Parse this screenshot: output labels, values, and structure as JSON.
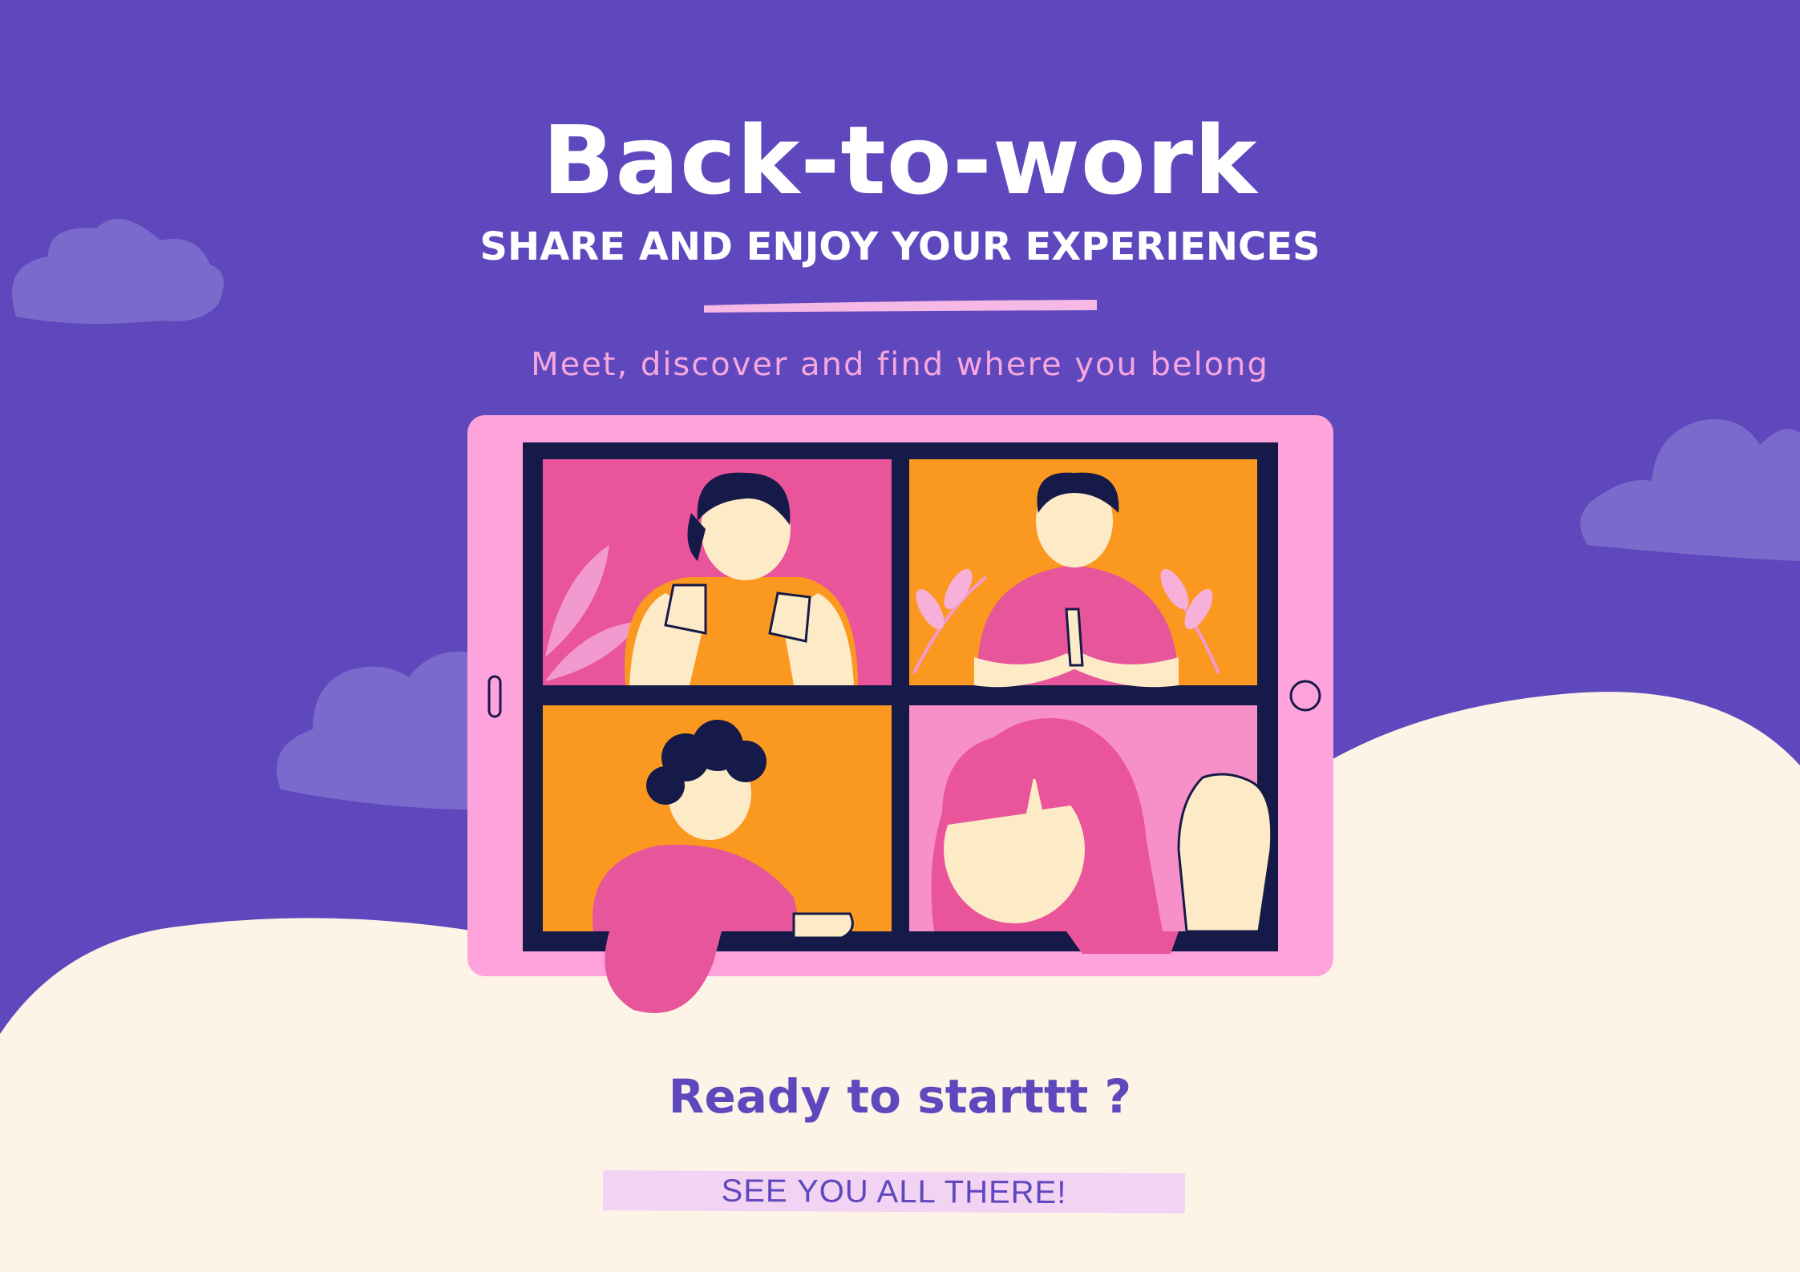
{
  "header": {
    "title": "Back-to-work",
    "subtitle": "SHARE AND ENJOY YOUR EXPERIENCES",
    "tagline": "Meet, discover and find where you belong"
  },
  "footer": {
    "ready_text": "Ready to starttt ?",
    "cta_label": "SEE YOU ALL THERE!"
  },
  "colors": {
    "background": "#5f48bd",
    "cloud": "#7a6acb",
    "hill": "#fdf4e7",
    "tablet": "#ffa3dc",
    "tile_pink": "#ea549b",
    "tile_orange": "#fb9820",
    "cta_bg": "#f3d3f3",
    "tagline": "#f7a6de"
  },
  "icons": [
    "cloud-icon",
    "tablet-illustration",
    "tablet-camera-icon",
    "tablet-home-button-icon"
  ]
}
